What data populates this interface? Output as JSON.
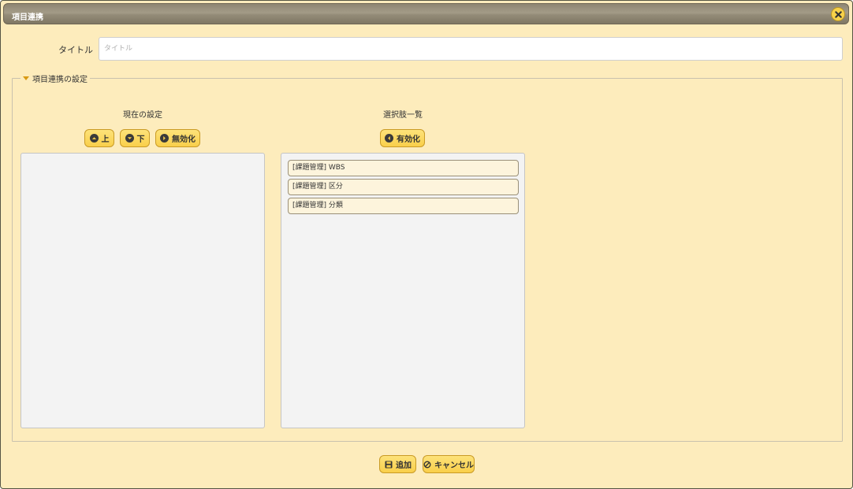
{
  "dialog": {
    "title": "項目連携"
  },
  "form": {
    "title_label": "タイトル",
    "title_value": "",
    "title_placeholder": "タイトル"
  },
  "section": {
    "legend": "項目連携の設定",
    "current": {
      "heading": "現在の設定",
      "buttons": {
        "up": "上",
        "down": "下",
        "disable": "無効化"
      },
      "items": []
    },
    "options": {
      "heading": "選択肢一覧",
      "buttons": {
        "enable": "有効化"
      },
      "items": [
        {
          "label": "[課題管理] WBS"
        },
        {
          "label": "[課題管理] 区分"
        },
        {
          "label": "[課題管理] 分類"
        }
      ]
    }
  },
  "footer": {
    "add": "追加",
    "cancel": "キャンセル"
  },
  "colors": {
    "panel": "#fdecbc",
    "button": "#f9cf4a",
    "titlebar": "#948c78"
  },
  "icons": {
    "close": "close-icon",
    "up": "chevron-up-circle-icon",
    "down": "chevron-down-circle-icon",
    "disable": "chevron-right-circle-icon",
    "enable": "chevron-left-circle-icon",
    "add": "save-icon",
    "cancel": "ban-icon"
  }
}
